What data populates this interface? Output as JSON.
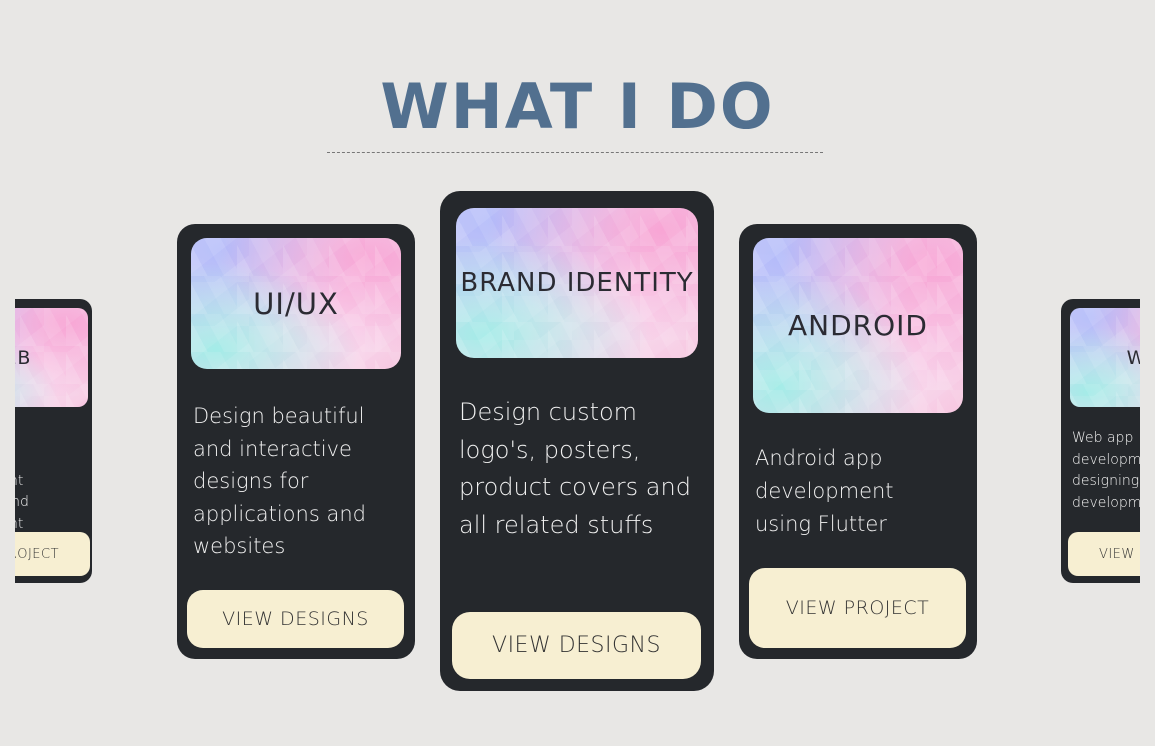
{
  "section": {
    "title": "WHAT I DO"
  },
  "cards": {
    "web_left": {
      "image_label": "WEB",
      "description": "Web app development designing and development",
      "button_label": "VIEW PROJECT"
    },
    "uiux": {
      "image_label": "UI/UX",
      "description": "Design beautiful and interactive designs for applications and websites",
      "button_label": "VIEW DESIGNS"
    },
    "brand": {
      "image_label": "BRAND IDENTITY",
      "description": "Design custom logo's, posters, product covers and all related stuffs",
      "button_label": "VIEW DESIGNS"
    },
    "android": {
      "image_label": "ANDROID",
      "description": "Android app development using Flutter",
      "button_label": "VIEW PROJECT"
    },
    "web_right": {
      "image_label": "WEB",
      "description": "Web app development designing and development",
      "button_label": "VIEW PROJECT"
    }
  },
  "colors": {
    "background": "#e8e7e5",
    "title": "#52708f",
    "card": "#25282c",
    "button": "#f7efd2"
  }
}
